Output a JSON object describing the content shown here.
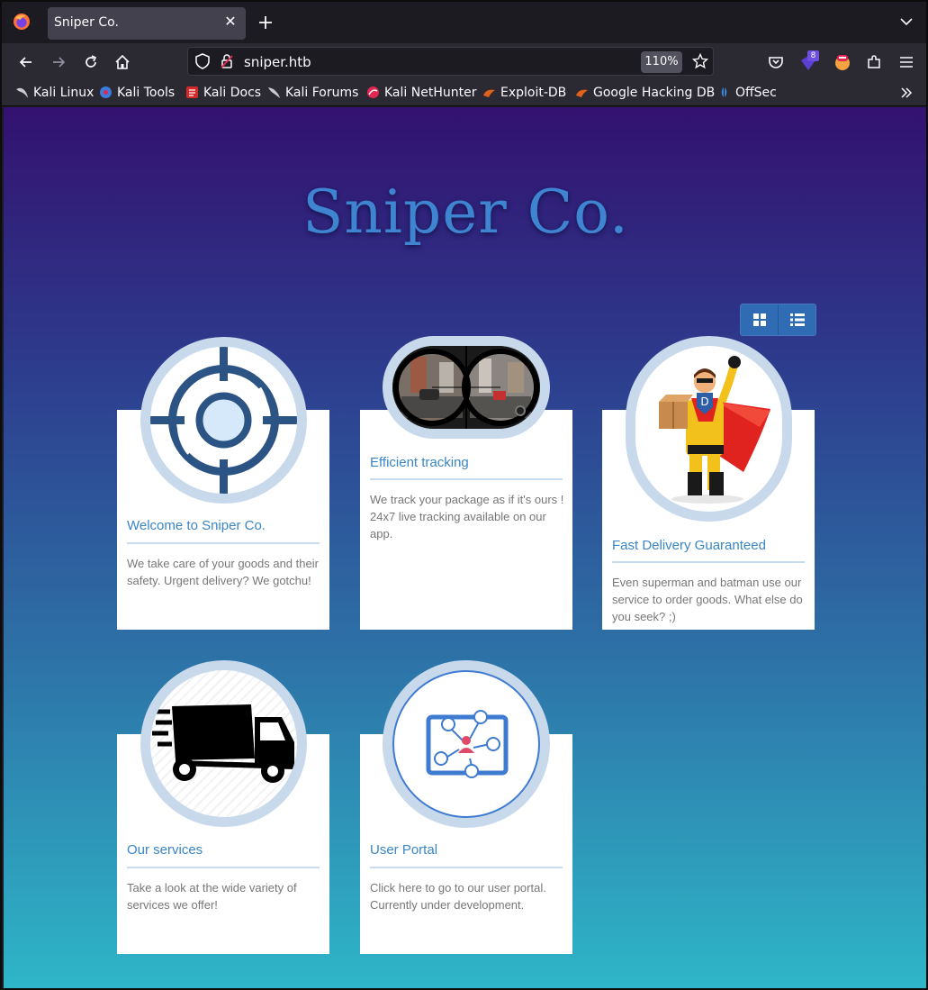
{
  "browser": {
    "tab_title": "Sniper Co.",
    "url": "sniper.htb",
    "zoom": "110%",
    "extension_badge": "8",
    "bookmarks": [
      "Kali Linux",
      "Kali Tools",
      "Kali Docs",
      "Kali Forums",
      "Kali NetHunter",
      "Exploit-DB",
      "Google Hacking DB",
      "OffSec"
    ]
  },
  "page": {
    "title": "Sniper Co.",
    "cards": [
      {
        "title": "Welcome to Sniper Co.",
        "text": "We take care of your goods and their safety. Urgent delivery? We gotchu!",
        "icon": "crosshair-icon"
      },
      {
        "title": "Efficient tracking",
        "text": "We track your package as if it's ours ! 24x7 live tracking available on our app.",
        "icon": "scope-image"
      },
      {
        "title": "Fast Delivery Guaranteed",
        "text": "Even superman and batman use our service to order goods. What else do you seek? ;)",
        "icon": "superhero-courier-image"
      },
      {
        "title": "Our services",
        "text": "Take a look at the wide variety of services we offer!",
        "icon": "truck-icon"
      },
      {
        "title": "User Portal",
        "text": "Click here to go to our user portal. Currently under development.",
        "icon": "user-network-icon"
      }
    ]
  },
  "colors": {
    "gradient_top": "#331170",
    "gradient_bottom": "#2eb6c8",
    "title_blue": "#3f84d0",
    "card_title": "#3a86c6"
  }
}
